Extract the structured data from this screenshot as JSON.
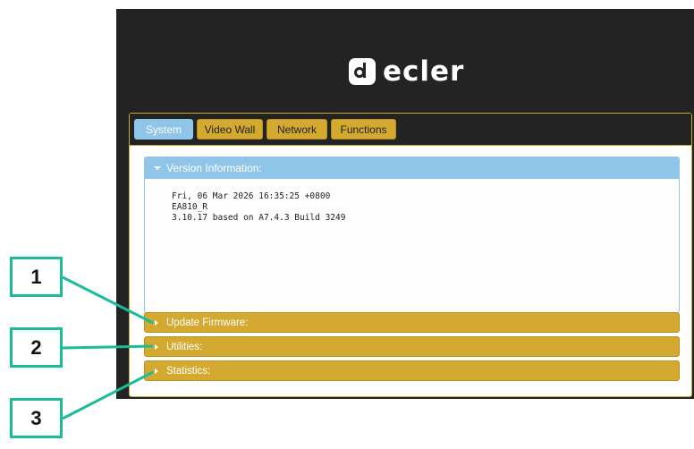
{
  "brand": {
    "logo_text": "ecler"
  },
  "tabs": [
    {
      "label": "System",
      "active": true
    },
    {
      "label": "Video Wall",
      "active": false
    },
    {
      "label": "Network",
      "active": false
    },
    {
      "label": "Functions",
      "active": false
    }
  ],
  "sections": {
    "version": {
      "title": "Version Information:",
      "lines": [
        "Fri, 06 Mar 2026 16:35:25 +0800",
        "EA810_R",
        "3.10.17 based on A7.4.3 Build 3249"
      ]
    },
    "update_firmware": {
      "title": "Update Firmware:"
    },
    "utilities": {
      "title": "Utilities:"
    },
    "statistics": {
      "title": "Statistics:"
    }
  },
  "callouts": [
    "1",
    "2",
    "3"
  ],
  "colors": {
    "accent_blue": "#8fc5e8",
    "accent_gold": "#d4a92f",
    "background_dark": "#232323",
    "callout_teal": "#1abc9c"
  },
  "icons": {
    "expanded": "caret-down-icon",
    "collapsed": "caret-right-icon"
  }
}
